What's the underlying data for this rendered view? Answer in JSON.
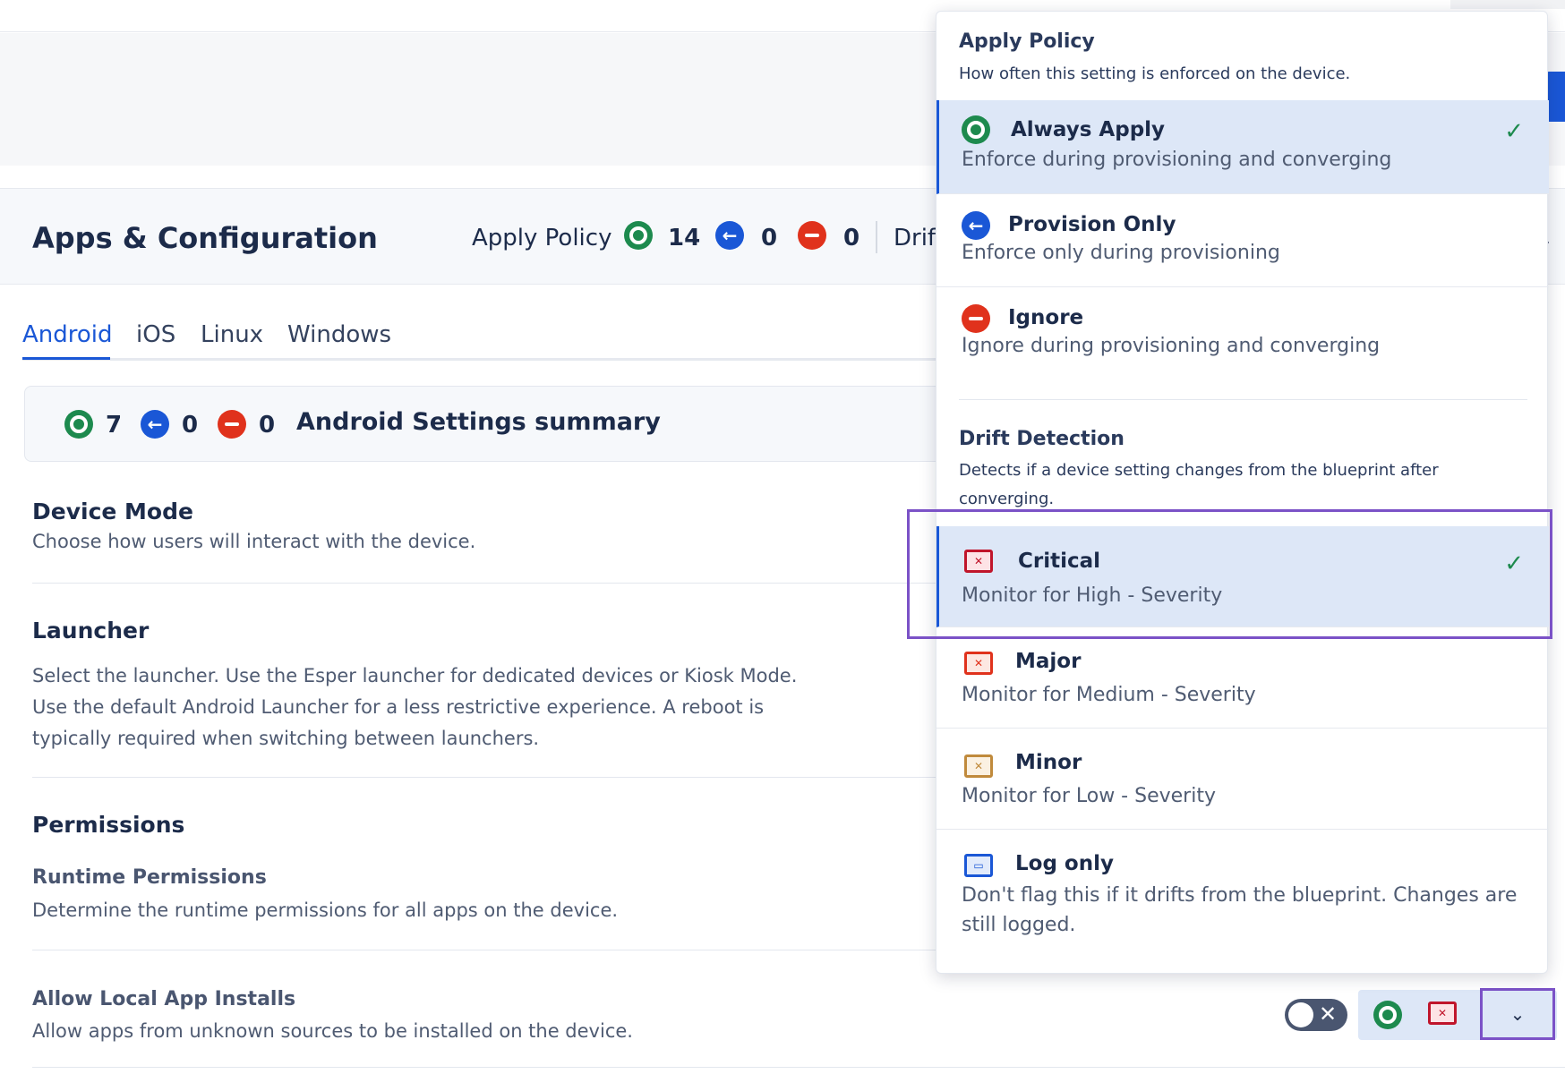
{
  "header": {
    "title": "Apps & Configuration",
    "apply_policy_label": "Apply Policy",
    "counts": {
      "always": "14",
      "provision": "0",
      "ignore": "0"
    },
    "drift_label": "Drif"
  },
  "tabs": [
    {
      "label": "Android"
    },
    {
      "label": "iOS"
    },
    {
      "label": "Linux"
    },
    {
      "label": "Windows"
    }
  ],
  "summary": {
    "counts": {
      "always": "7",
      "provision": "0",
      "ignore": "0"
    },
    "title": "Android Settings summary"
  },
  "sections": {
    "device_mode": {
      "title": "Device Mode",
      "desc": "Choose how users will interact with the device."
    },
    "launcher": {
      "title": "Launcher",
      "desc_lines": [
        "Select the launcher. Use the Esper launcher for dedicated devices or Kiosk Mode.",
        "Use the default Android Launcher for a less restrictive experience. A reboot is",
        "typically required when switching between launchers."
      ]
    },
    "permissions": {
      "title": "Permissions",
      "runtime_title": "Runtime Permissions",
      "runtime_desc": "Determine the runtime permissions for all apps on the device."
    },
    "local_installs": {
      "title": "Allow Local App Installs",
      "desc": "Allow apps from unknown sources to be installed on the device."
    }
  },
  "dropdown": {
    "apply_policy": {
      "heading": "Apply Policy",
      "subheading": "How often this setting is enforced on the device.",
      "options": [
        {
          "title": "Always Apply",
          "desc": "Enforce during provisioning and converging",
          "selected": true
        },
        {
          "title": "Provision Only",
          "desc": "Enforce only during provisioning",
          "selected": false
        },
        {
          "title": "Ignore",
          "desc": "Ignore during provisioning and converging",
          "selected": false
        }
      ]
    },
    "drift_detection": {
      "heading": "Drift Detection",
      "subheading": "Detects if a device setting changes from the blueprint after converging.",
      "options": [
        {
          "title": "Critical",
          "desc": "Monitor for High - Severity",
          "selected": true
        },
        {
          "title": "Major",
          "desc": "Monitor for Medium - Severity",
          "selected": false
        },
        {
          "title": "Minor",
          "desc": "Monitor for Low - Severity",
          "selected": false
        },
        {
          "title": "Log only",
          "desc": "Don't flag this if it drifts from the blueprint. Changes are still logged.",
          "selected": false
        }
      ]
    }
  },
  "icons": {
    "always": "green-circle-icon",
    "provision": "blue-arrow-left-icon",
    "ignore": "red-minus-icon",
    "critical": "critical-monitor-icon",
    "major": "major-monitor-icon",
    "minor": "minor-monitor-icon",
    "log": "log-monitor-icon",
    "check": "checkmark-icon",
    "chevron": "chevron-down-icon"
  },
  "colors": {
    "accent": "#1a57d6",
    "green": "#1d8a4e",
    "red": "#e0321c",
    "critical": "#c0152b",
    "minor": "#c08a3c",
    "highlight": "#7b52c7"
  },
  "glyphs": {
    "arrow": "←",
    "check": "✓",
    "chevron": "⌄",
    "x": "✕",
    "log": "▭"
  }
}
